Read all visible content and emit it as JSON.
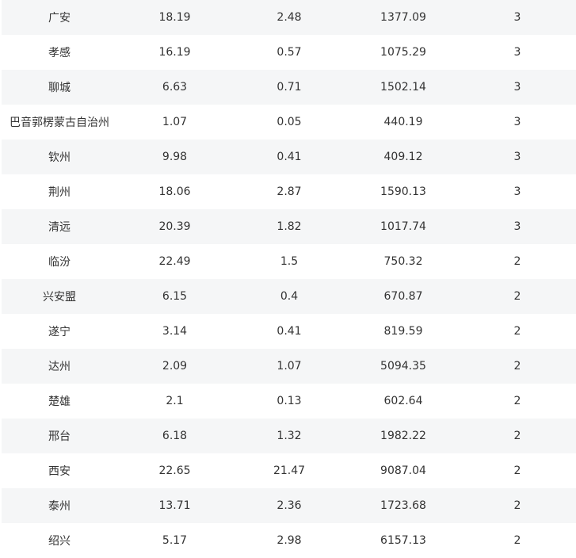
{
  "table": {
    "rows": [
      [
        "广安",
        "18.19",
        "2.48",
        "1377.09",
        "3"
      ],
      [
        "孝感",
        "16.19",
        "0.57",
        "1075.29",
        "3"
      ],
      [
        "聊城",
        "6.63",
        "0.71",
        "1502.14",
        "3"
      ],
      [
        "巴音郭楞蒙古自治州",
        "1.07",
        "0.05",
        "440.19",
        "3"
      ],
      [
        "钦州",
        "9.98",
        "0.41",
        "409.12",
        "3"
      ],
      [
        "荆州",
        "18.06",
        "2.87",
        "1590.13",
        "3"
      ],
      [
        "清远",
        "20.39",
        "1.82",
        "1017.74",
        "3"
      ],
      [
        "临汾",
        "22.49",
        "1.5",
        "750.32",
        "2"
      ],
      [
        "兴安盟",
        "6.15",
        "0.4",
        "670.87",
        "2"
      ],
      [
        "遂宁",
        "3.14",
        "0.41",
        "819.59",
        "2"
      ],
      [
        "达州",
        "2.09",
        "1.07",
        "5094.35",
        "2"
      ],
      [
        "楚雄",
        "2.1",
        "0.13",
        "602.64",
        "2"
      ],
      [
        "邢台",
        "6.18",
        "1.32",
        "1982.22",
        "2"
      ],
      [
        "西安",
        "22.65",
        "21.47",
        "9087.04",
        "2"
      ],
      [
        "泰州",
        "13.71",
        "2.36",
        "1723.68",
        "2"
      ],
      [
        "绍兴",
        "5.17",
        "2.98",
        "6157.13",
        "2"
      ]
    ]
  }
}
